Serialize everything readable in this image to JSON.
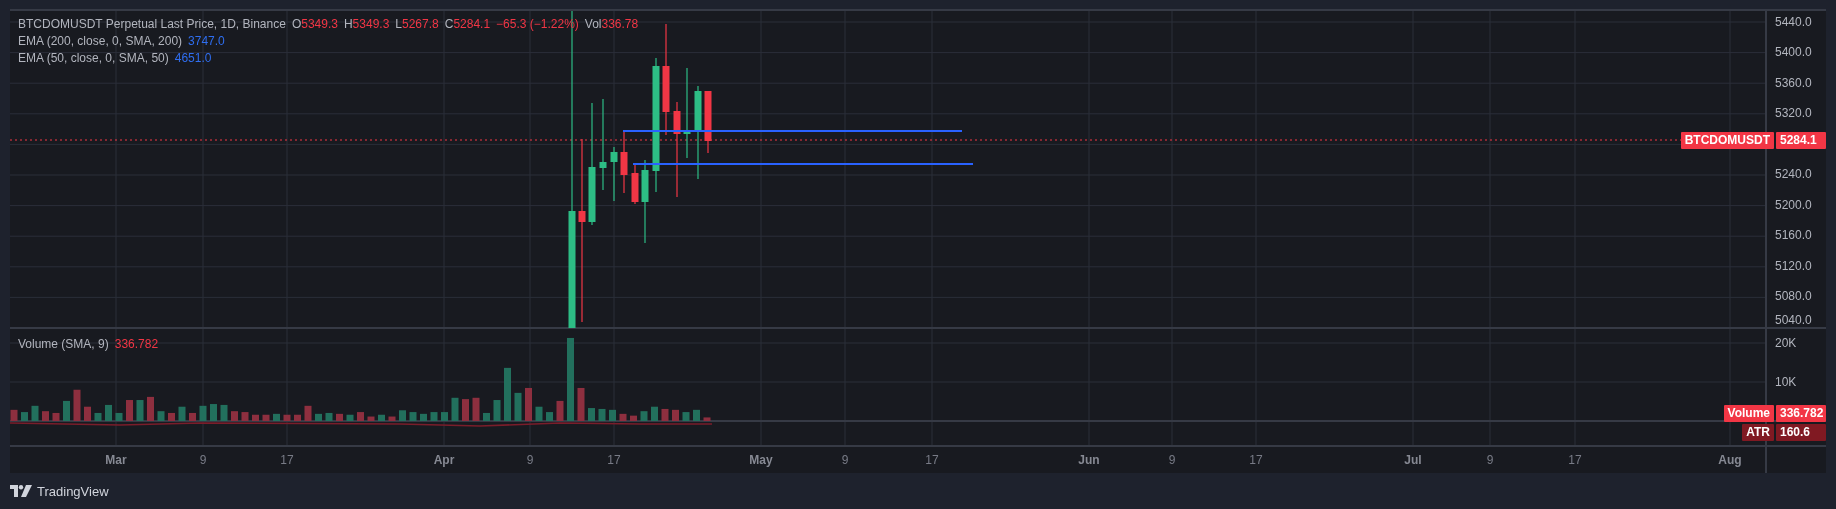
{
  "legend": {
    "symbol": "BTCDOMUSDT Perpetual Last Price, 1D, Binance",
    "ohlc": [
      {
        "label": "O",
        "value": "5349.3"
      },
      {
        "label": "H",
        "value": "5349.3"
      },
      {
        "label": "L",
        "value": "5267.8"
      },
      {
        "label": "C",
        "value": "5284.1"
      }
    ],
    "change": "−65.3 (−1.22%)",
    "volume_label": "Vol",
    "volume_value": "336.78"
  },
  "indicators": [
    {
      "name": "EMA (200, close, 0, SMA, 200)",
      "value": "3747.0"
    },
    {
      "name": "EMA (50, close, 0, SMA, 50)",
      "value": "4651.0"
    }
  ],
  "price_axis": [
    "5440.0",
    "5400.0",
    "5360.0",
    "5320.0",
    "5240.0",
    "5200.0",
    "5160.0",
    "5120.0",
    "5080.0",
    "5040.0"
  ],
  "price_tag": {
    "symbol": "BTCDOMUSDT",
    "value": "5284.1"
  },
  "volume_pane": {
    "name": "Volume (SMA, 9)",
    "value": "336.782",
    "axis": [
      "20K",
      "10K"
    ],
    "tag": {
      "label": "Volume",
      "value": "336.782"
    }
  },
  "atr_pane": {
    "tag": {
      "label": "ATR",
      "value": "160.6"
    }
  },
  "time_axis": [
    {
      "label": "Mar",
      "kind": "month"
    },
    {
      "label": "9",
      "kind": "day"
    },
    {
      "label": "17",
      "kind": "day"
    },
    {
      "label": "Apr",
      "kind": "month"
    },
    {
      "label": "9",
      "kind": "day"
    },
    {
      "label": "17",
      "kind": "day"
    },
    {
      "label": "May",
      "kind": "month"
    },
    {
      "label": "9",
      "kind": "day"
    },
    {
      "label": "17",
      "kind": "day"
    },
    {
      "label": "Jun",
      "kind": "month"
    },
    {
      "label": "9",
      "kind": "day"
    },
    {
      "label": "17",
      "kind": "day"
    },
    {
      "label": "Jul",
      "kind": "month"
    },
    {
      "label": "9",
      "kind": "day"
    },
    {
      "label": "17",
      "kind": "day"
    },
    {
      "label": "Aug",
      "kind": "month"
    }
  ],
  "footer": {
    "brand": "TradingView"
  }
}
